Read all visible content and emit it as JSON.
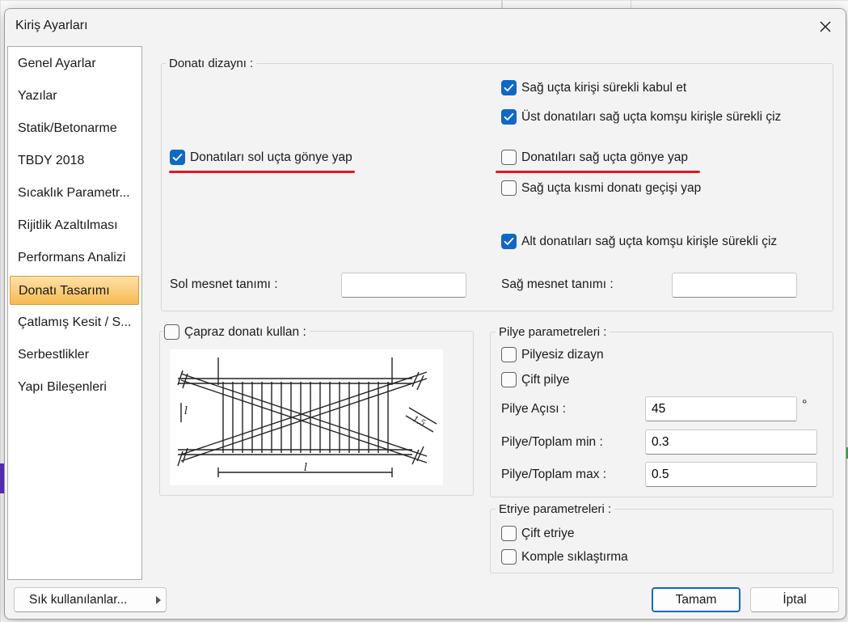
{
  "dialog": {
    "title": "Kiriş Ayarları",
    "close_glyph": "✕"
  },
  "sidebar": {
    "items": [
      {
        "label": "Genel Ayarlar",
        "selected": false
      },
      {
        "label": "Yazılar",
        "selected": false
      },
      {
        "label": "Statik/Betonarme",
        "selected": false
      },
      {
        "label": "TBDY 2018",
        "selected": false
      },
      {
        "label": "Sıcaklık Parametr...",
        "selected": false
      },
      {
        "label": "Rijitlik Azaltılması",
        "selected": false
      },
      {
        "label": "Performans Analizi",
        "selected": false
      },
      {
        "label": "Donatı Tasarımı",
        "selected": true
      },
      {
        "label": "Çatlamış Kesit / S...",
        "selected": false
      },
      {
        "label": "Serbestlikler",
        "selected": false
      },
      {
        "label": "Yapı Bileşenleri",
        "selected": false
      }
    ]
  },
  "donati_dizayni": {
    "group_label": "Donatı dizaynı :",
    "checkboxes": {
      "sag_ucta_kirisi_surekli": {
        "label": "Sağ uçta kirişi sürekli kabul et",
        "checked": true
      },
      "ust_donati_surekli": {
        "label": "Üst donatıları sağ uçta komşu kirişle sürekli çiz",
        "checked": true
      },
      "sol_ucta_gonye": {
        "label": "Donatıları sol uçta gönye yap",
        "checked": true
      },
      "sag_ucta_gonye": {
        "label": "Donatıları sağ uçta gönye yap",
        "checked": false
      },
      "kismi_donati": {
        "label": "Sağ uçta kısmi donatı geçişi yap",
        "checked": false
      },
      "alt_donati_surekli": {
        "label": "Alt donatıları sağ uçta komşu kirişle sürekli çiz",
        "checked": true
      }
    },
    "sol_mesnet_label": "Sol mesnet tanımı :",
    "sol_mesnet_value": "",
    "sag_mesnet_label": "Sağ mesnet tanımı :",
    "sag_mesnet_value": ""
  },
  "capraz": {
    "label": "Çapraz donatı kullan :",
    "checked": false,
    "figure_labels": {
      "dim_left": "l",
      "dim_right": "1,5",
      "span": "l"
    }
  },
  "pilye": {
    "group_label": "Pilye parametreleri :",
    "pilyesiz": {
      "label": "Pilyesiz dizayn",
      "checked": false
    },
    "cift_pilye": {
      "label": "Çift pilye",
      "checked": false
    },
    "aci_label": "Pilye Açısı :",
    "aci_value": "45",
    "aci_unit": "°",
    "min_label": "Pilye/Toplam min :",
    "min_value": "0.3",
    "max_label": "Pilye/Toplam max :",
    "max_value": "0.5"
  },
  "etriye": {
    "group_label": "Etriye parametreleri :",
    "cift_etriye": {
      "label": "Çift etriye",
      "checked": false
    },
    "komple": {
      "label": "Komple sıklaştırma",
      "checked": false
    }
  },
  "footer": {
    "favorites_label": "Sık kullanılanlar...",
    "ok_label": "Tamam",
    "cancel_label": "İptal"
  },
  "colors": {
    "accent": "#0f67c7",
    "selection": "#f6b94f",
    "annotation": "#e8141f"
  }
}
